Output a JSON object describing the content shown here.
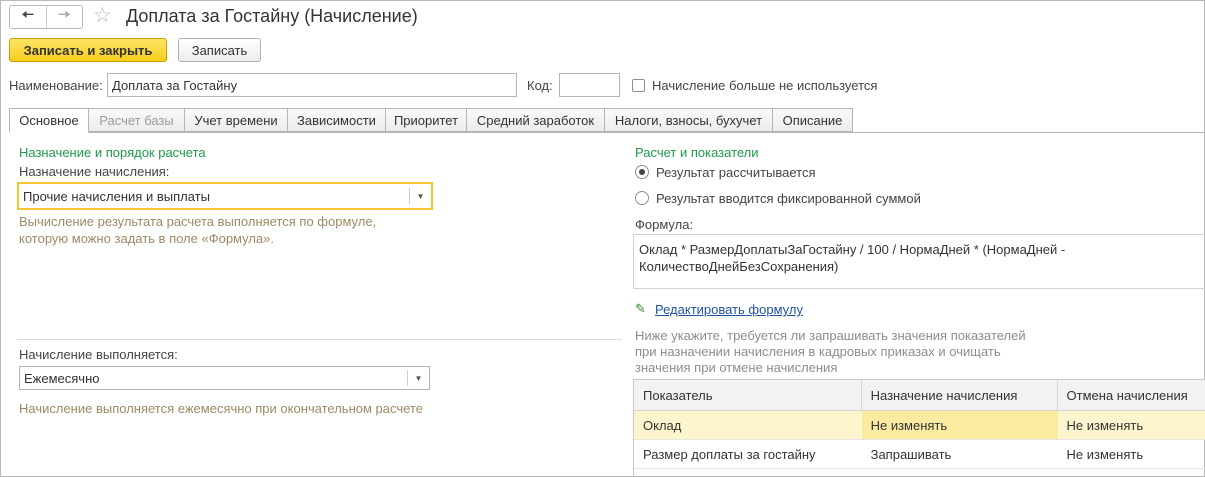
{
  "window": {
    "title": "Доплата за Гостайну (Начисление)"
  },
  "toolbar": {
    "save_close_label": "Записать и закрыть",
    "save_label": "Записать"
  },
  "name_row": {
    "name_label": "Наименование:",
    "name_value": "Доплата за Гостайну",
    "code_label": "Код:",
    "code_value": "",
    "unused_label": "Начисление больше не используется"
  },
  "tabs": [
    {
      "label": "Основное"
    },
    {
      "label": "Расчет базы"
    },
    {
      "label": "Учет времени"
    },
    {
      "label": "Зависимости"
    },
    {
      "label": "Приоритет"
    },
    {
      "label": "Средний заработок"
    },
    {
      "label": "Налоги, взносы, бухучет"
    },
    {
      "label": "Описание"
    }
  ],
  "left": {
    "section_title": "Назначение и порядок расчета",
    "purpose_label": "Назначение начисления:",
    "purpose_value": "Прочие начисления и выплаты",
    "hint_line1": "Вычисление результата расчета выполняется по формуле,",
    "hint_line2": "которую можно задать в поле «Формула».",
    "perform_label": "Начисление выполняется:",
    "perform_value": "Ежемесячно",
    "perform_hint": "Начисление выполняется ежемесячно при окончательном расчете"
  },
  "right": {
    "section_title": "Расчет и показатели",
    "radio_calc": "Результат рассчитывается",
    "radio_fixed": "Результат вводится фиксированной суммой",
    "formula_label": "Формула:",
    "formula_line1": "Оклад * РазмерДоплатыЗаГостайну / 100 / НормаДней * (НормаДней -",
    "formula_line2": "КоличествоДнейБезСохранения)",
    "edit_formula_link": "Редактировать формулу",
    "note_line1": "Ниже укажите, требуется ли запрашивать значения показателей",
    "note_line2": "при назначении начисления в кадровых приказах и очищать",
    "note_line3": "значения при отмене начисления"
  },
  "table": {
    "headers": [
      "Показатель",
      "Назначение начисления",
      "Отмена начисления"
    ],
    "rows": [
      [
        "Оклад",
        "Не изменять",
        "Не изменять"
      ],
      [
        "Размер доплаты за гостайну",
        "Запрашивать",
        "Не изменять"
      ]
    ]
  },
  "colors": {
    "accent_yellow": "#f6cd1c",
    "section_green": "#1e9a4b",
    "link_blue": "#2053a4",
    "hint_brown": "#9c8b62"
  }
}
